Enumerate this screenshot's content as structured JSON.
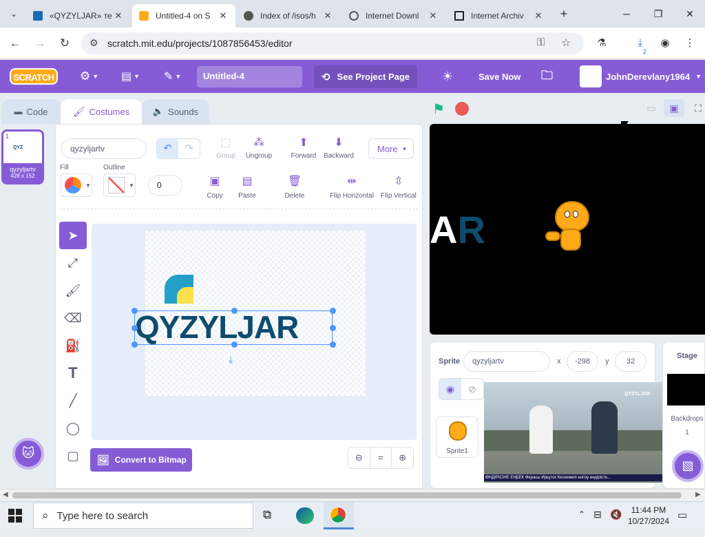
{
  "browser": {
    "tabs": [
      {
        "label": "«QYZYLJAR» те",
        "active": false
      },
      {
        "label": "Untitled-4 on S",
        "active": true
      },
      {
        "label": "Index of /isos/h",
        "active": false
      },
      {
        "label": "Internet Downl",
        "active": false
      },
      {
        "label": "Internet Archiv",
        "active": false
      }
    ],
    "url": "scratch.mit.edu/projects/1087856453/editor",
    "download_badge": "2"
  },
  "menubar": {
    "logo": "SCRATCH",
    "project_title": "Untitled-4",
    "see_project_page": "See Project Page",
    "save_now": "Save Now",
    "username": "JohnDerevlany1964"
  },
  "editor_tabs": {
    "code": "Code",
    "costumes": "Costumes",
    "sounds": "Sounds"
  },
  "costume_list": {
    "items": [
      {
        "index": "1",
        "name": "qyzyljartv",
        "size": "428 x 152",
        "thumb_text": "QYZ"
      }
    ]
  },
  "paint_editor": {
    "costume_name": "qyzyljartv",
    "group": "Group",
    "ungroup": "Ungroup",
    "forward": "Forward",
    "backward": "Backward",
    "more": "More",
    "fill_label": "Fill",
    "outline_label": "Outline",
    "outline_width": "0",
    "copy": "Copy",
    "paste": "Paste",
    "delete": "Delete",
    "flip_horizontal": "Flip Horizontal",
    "flip_vertical": "Flip Vertical",
    "convert_to_bitmap": "Convert to Bitmap",
    "canvas_text": "QYZYLJAR",
    "zoom_reset": "="
  },
  "stage": {
    "stage_text": "AR"
  },
  "sprite_info": {
    "sprite_label": "Sprite",
    "sprite_name": "qyzyljartv",
    "x_label": "x",
    "x_value": "-298",
    "y_label": "y",
    "y_value": "32",
    "sprite_tile": "Sprite1",
    "video_overlay_brand": "QYZYLJAR",
    "video_overlay_ticker": "ӨНДІРІСІНЕ ЕҢБЕК  Ферасы Иркутск Кескемелі енгізу өндірісте..."
  },
  "stage_pane": {
    "title": "Stage",
    "backdrops_label": "Backdrops",
    "backdrops_count": "1"
  },
  "taskbar": {
    "search_placeholder": "Type here to search",
    "time": "11:44 PM",
    "date": "10/27/2024"
  },
  "colors": {
    "scratch_purple": "#855cd6",
    "scratch_blue": "#4c97ff",
    "text_gray": "#575e75",
    "logo_orange": "#ffab19",
    "qyzyljar_dark": "#0d4c6e",
    "qyzyljar_teal": "#24a0c8"
  }
}
